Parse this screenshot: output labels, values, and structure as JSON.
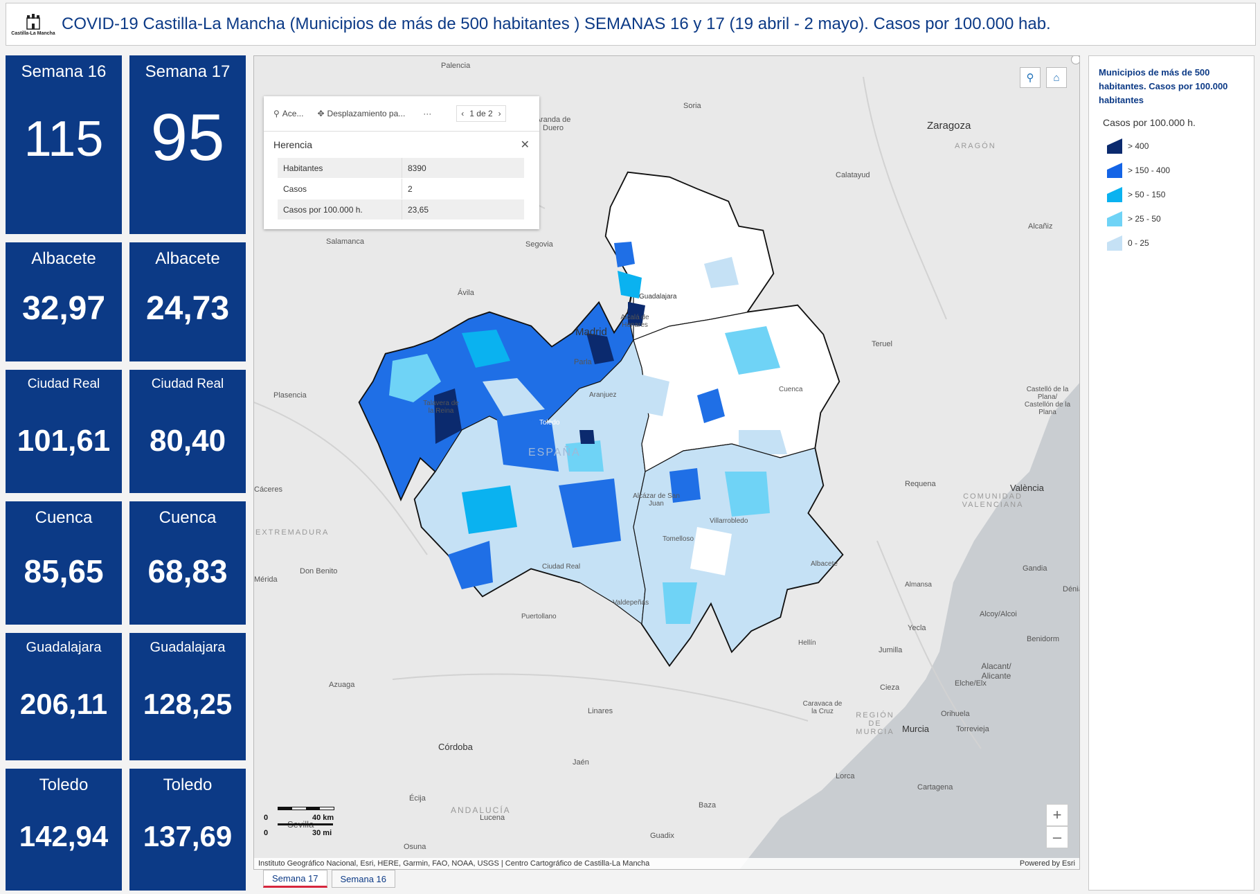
{
  "header": {
    "logo_text": "Castilla-La Mancha",
    "title": "COVID-19 Castilla-La Mancha (Municipios de más de 500 habitantes ) SEMANAS 16 y 17 (19 abril - 2 mayo). Casos por 100.000 hab."
  },
  "tiles": [
    {
      "label": "Semana 16",
      "value": "115"
    },
    {
      "label": "Semana 17",
      "value": "95"
    },
    {
      "label": "Albacete",
      "value": "32,97"
    },
    {
      "label": "Albacete",
      "value": "24,73"
    },
    {
      "label": "Ciudad Real",
      "value": "101,61"
    },
    {
      "label": "Ciudad Real",
      "value": "80,40"
    },
    {
      "label": "Cuenca",
      "value": "85,65"
    },
    {
      "label": "Cuenca",
      "value": "68,83"
    },
    {
      "label": "Guadalajara",
      "value": "206,11"
    },
    {
      "label": "Guadalajara",
      "value": "128,25"
    },
    {
      "label": "Toledo",
      "value": "142,94"
    },
    {
      "label": "Toledo",
      "value": "137,69"
    }
  ],
  "popup": {
    "zoom_label": "Ace...",
    "pan_label": "Desplazamiento pa...",
    "more_label": "···",
    "pager": "1 de 2",
    "feature_title": "Herencia",
    "rows": [
      {
        "k": "Habitantes",
        "v": "8390"
      },
      {
        "k": "Casos",
        "v": "2"
      },
      {
        "k": "Casos por 100.000 h.",
        "v": "23,65"
      }
    ]
  },
  "places": [
    {
      "name": "Palencia"
    },
    {
      "name": "Soria"
    },
    {
      "name": "Aranda de Duero"
    },
    {
      "name": "Zaragoza"
    },
    {
      "name": "ARAGÓN"
    },
    {
      "name": "Calatayud"
    },
    {
      "name": "Alcañiz"
    },
    {
      "name": "Salamanca"
    },
    {
      "name": "Segovia"
    },
    {
      "name": "Ávila"
    },
    {
      "name": "Guadalajara"
    },
    {
      "name": "Alcalá de Henares"
    },
    {
      "name": "Madrid"
    },
    {
      "name": "Teruel"
    },
    {
      "name": "Parla"
    },
    {
      "name": "Plasencia"
    },
    {
      "name": "Talavera de la Reina"
    },
    {
      "name": "Toledo"
    },
    {
      "name": "Aranjuez"
    },
    {
      "name": "Cuenca"
    },
    {
      "name": "Castelló de la Plana/ Castellón de la Plana"
    },
    {
      "name": "ESPAÑA"
    },
    {
      "name": "Requena"
    },
    {
      "name": "València"
    },
    {
      "name": "COMUNIDAD VALENCIANA"
    },
    {
      "name": "Alcázar de San Juan"
    },
    {
      "name": "EXTREMADURA"
    },
    {
      "name": "Villarrobledo"
    },
    {
      "name": "Tomelloso"
    },
    {
      "name": "Don Benito"
    },
    {
      "name": "Ciudad Real"
    },
    {
      "name": "Albacete"
    },
    {
      "name": "Almansa"
    },
    {
      "name": "Gandia"
    },
    {
      "name": "Dénia"
    },
    {
      "name": "Valdepeñas"
    },
    {
      "name": "Puertollano"
    },
    {
      "name": "Alcoy/Alcoi"
    },
    {
      "name": "Yecla"
    },
    {
      "name": "Benidorm"
    },
    {
      "name": "Hellín"
    },
    {
      "name": "Jumilla"
    },
    {
      "name": "Alacant/ Alicante"
    },
    {
      "name": "Cieza"
    },
    {
      "name": "Elche/Elx"
    },
    {
      "name": "Azuaga"
    },
    {
      "name": "Linares"
    },
    {
      "name": "Caravaca de la Cruz"
    },
    {
      "name": "REGIÓN DE MURCIA"
    },
    {
      "name": "Orihuela"
    },
    {
      "name": "Murcia"
    },
    {
      "name": "Torrevieja"
    },
    {
      "name": "Córdoba"
    },
    {
      "name": "Jaén"
    },
    {
      "name": "Lorca"
    },
    {
      "name": "Cartagena"
    },
    {
      "name": "Écija"
    },
    {
      "name": "ANDALUCÍA"
    },
    {
      "name": "Baza"
    },
    {
      "name": "Lucena"
    },
    {
      "name": "Sevilla"
    },
    {
      "name": "Osuna"
    },
    {
      "name": "Guadix"
    },
    {
      "name": "Mérida"
    },
    {
      "name": "Cáceres"
    }
  ],
  "scale": {
    "km": "40 km",
    "mi": "30 mi",
    "zero": "0"
  },
  "attribution": {
    "left": "Instituto Geográfico Nacional, Esri, HERE, Garmin, FAO, NOAA, USGS | Centro Cartográfico de Castilla-La Mancha",
    "right": "Powered by Esri"
  },
  "legend": {
    "title": "Municipios de más de 500 habitantes. Casos por 100.000 habitantes",
    "subtitle": "Casos por 100.000 h.",
    "classes": [
      {
        "label": "> 400",
        "color": "#0b2a6e"
      },
      {
        "label": "> 150 - 400",
        "color": "#1464e6"
      },
      {
        "label": "> 50 - 150",
        "color": "#0ab2f0"
      },
      {
        "label": "> 25 - 50",
        "color": "#6fd3f6"
      },
      {
        "label": "0 - 25",
        "color": "#c5e1f5"
      }
    ]
  },
  "tabs": [
    {
      "label": "Semana 17",
      "active": true
    },
    {
      "label": "Semana 16",
      "active": false
    }
  ]
}
